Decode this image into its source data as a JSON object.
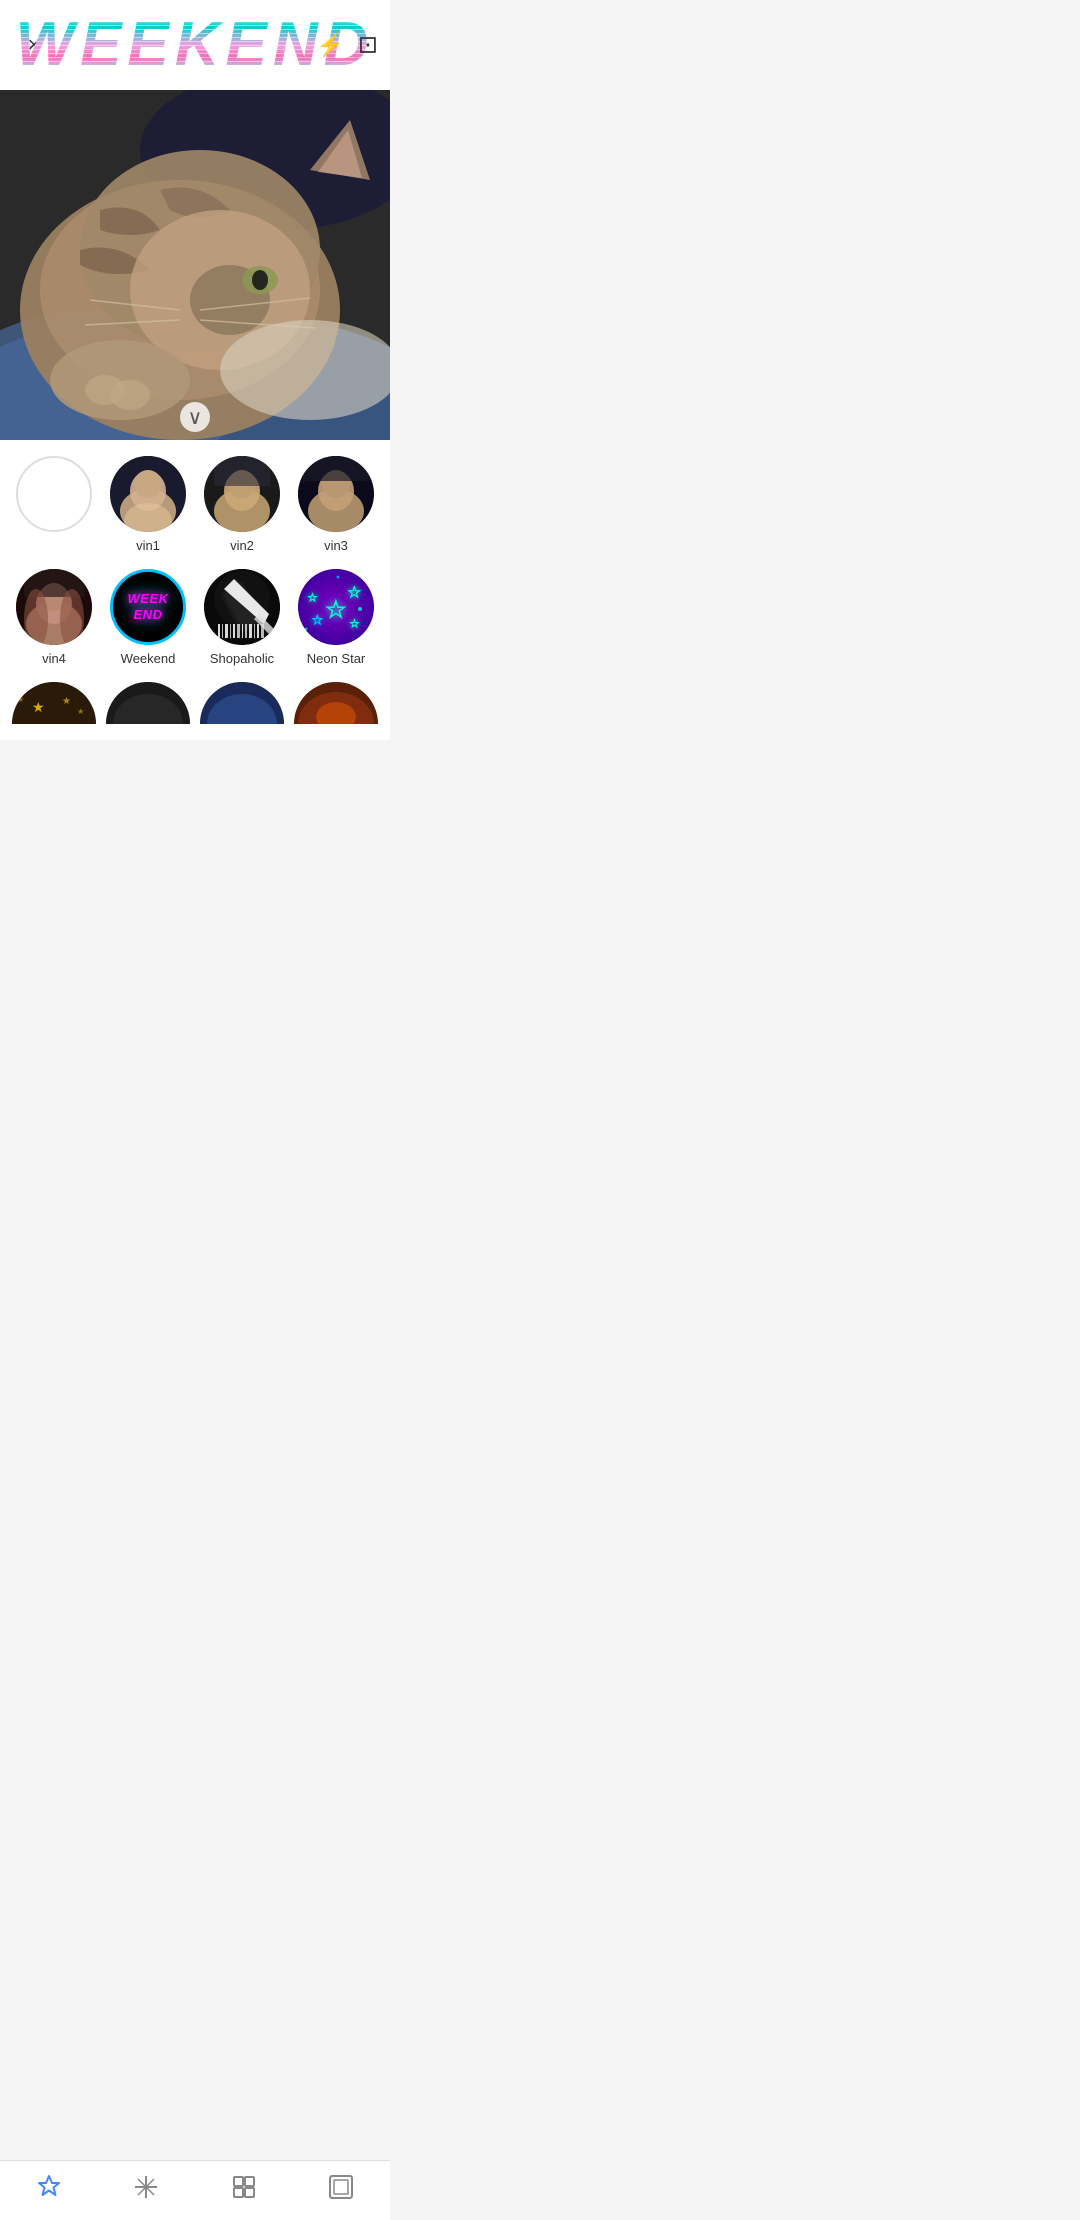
{
  "header": {
    "close_label": "×",
    "title": "WEEKEND",
    "flash_icon": "⚡",
    "save_icon": "⊡"
  },
  "weekend_title": {
    "text": "WEEKEND"
  },
  "image": {
    "alt": "Cat sleeping on blue fabric"
  },
  "chevron": {
    "icon": "∨"
  },
  "filters": {
    "row1": [
      {
        "id": "empty",
        "label": "",
        "type": "empty"
      },
      {
        "id": "vin1",
        "label": "vin1",
        "type": "portrait",
        "variant": "vin1"
      },
      {
        "id": "vin2",
        "label": "vin2",
        "type": "portrait",
        "variant": "vin2"
      },
      {
        "id": "vin3",
        "label": "vin3",
        "type": "portrait",
        "variant": "vin3"
      }
    ],
    "row2": [
      {
        "id": "vin4",
        "label": "vin4",
        "type": "portrait",
        "variant": "vin4"
      },
      {
        "id": "weekend",
        "label": "Weekend",
        "type": "weekend",
        "selected": true
      },
      {
        "id": "shopaholic",
        "label": "Shopaholic",
        "type": "shopaholic"
      },
      {
        "id": "neonstar",
        "label": "Neon Star",
        "type": "neonstar"
      }
    ],
    "row3": [
      {
        "id": "partial1",
        "label": "",
        "type": "partial",
        "variant": "gold"
      },
      {
        "id": "partial2",
        "label": "",
        "type": "partial",
        "variant": "dark"
      },
      {
        "id": "partial3",
        "label": "",
        "type": "partial",
        "variant": "blue"
      },
      {
        "id": "partial4",
        "label": "",
        "type": "partial",
        "variant": "warm"
      }
    ]
  },
  "nav": {
    "items": [
      {
        "id": "star",
        "icon": "☆",
        "active": true
      },
      {
        "id": "effects",
        "icon": "✦",
        "active": false
      },
      {
        "id": "edit",
        "icon": "⊞",
        "active": false
      },
      {
        "id": "frame",
        "icon": "▣",
        "active": false
      }
    ]
  }
}
